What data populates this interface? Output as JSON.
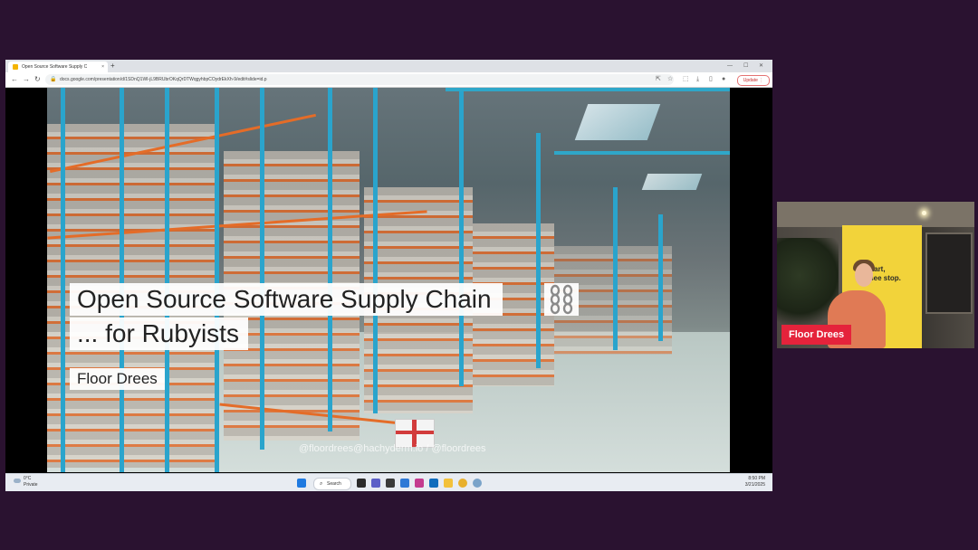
{
  "browser": {
    "tab_title": "Open Source Software Supply C",
    "url": "docs.google.com/presentation/d/1SDnQ1WI-jL9BRUbrOKqQrDTWqgyhbpCOydrEkXh-9/edit#slide=id.p",
    "update_label": "Update"
  },
  "slide": {
    "title_line1": "Open Source Software Supply Chain",
    "title_line2": "... for Rubyists",
    "speaker": "Floor Drees",
    "handles": "@floordrees@hachyderm.io / @floordrees"
  },
  "taskbar": {
    "weather_temp": "0°C",
    "weather_desc": "Private",
    "search_label": "Search",
    "time": "8:50 PM",
    "date": "3/21/2025"
  },
  "webcam": {
    "banner_text": "start,\n see stop.",
    "name_tag": "Floor Drees",
    "banner_color": "#f2d33a",
    "tag_color": "#e5233b"
  }
}
